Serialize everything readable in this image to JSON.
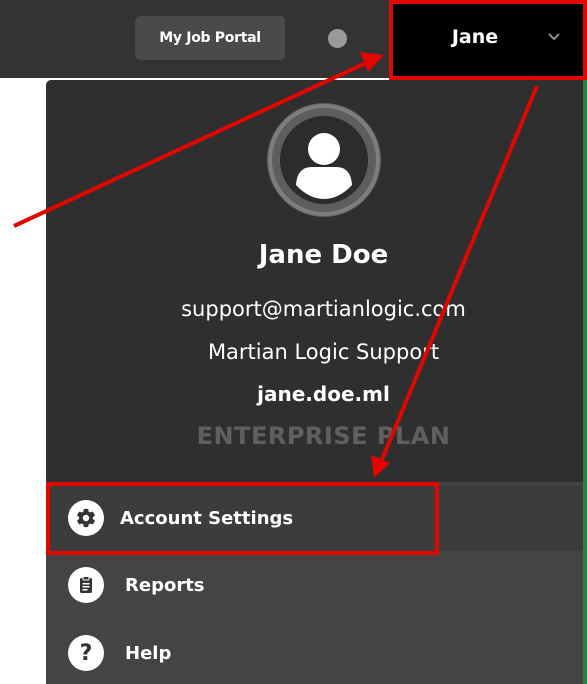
{
  "topbar": {
    "portal_button_label": "My Job Portal",
    "user_menu_label": "Jane"
  },
  "profile": {
    "name": "Jane Doe",
    "email": "support@martianlogic.com",
    "company": "Martian Logic Support",
    "username": "jane.doe.ml",
    "plan": "ENTERPRISE PLAN"
  },
  "menu": {
    "items": [
      {
        "label": "Account Settings",
        "icon": "gear-icon"
      },
      {
        "label": "Reports",
        "icon": "clipboard-icon"
      },
      {
        "label": "Help",
        "icon": "question-icon"
      }
    ]
  },
  "colors": {
    "topbar": "#333333",
    "panel": "#2f2f2f",
    "menu": "#444444",
    "annotation": "#e10600"
  }
}
